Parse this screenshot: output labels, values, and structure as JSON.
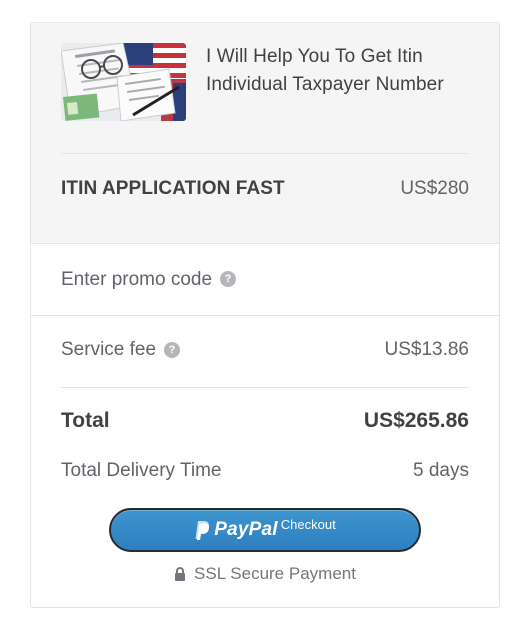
{
  "gig": {
    "thumbnail_icon": "itin-documents-photo",
    "title": "I Will Help You To Get Itin Individual Taxpayer Number"
  },
  "package": {
    "name": "ITIN APPLICATION FAST",
    "price": "US$280"
  },
  "promo": {
    "label": "Enter promo code",
    "help_icon": "question-circle-icon"
  },
  "service_fee": {
    "label": "Service fee",
    "help_icon": "question-circle-icon",
    "price": "US$13.86"
  },
  "total": {
    "label": "Total",
    "price": "US$265.86"
  },
  "delivery": {
    "label": "Total Delivery Time",
    "value": "5 days"
  },
  "paypal_button": {
    "brand": "PayPal",
    "label": "Checkout",
    "color": "#3d95ce"
  },
  "ssl": {
    "icon": "lock-icon",
    "text": "SSL Secure Payment"
  }
}
